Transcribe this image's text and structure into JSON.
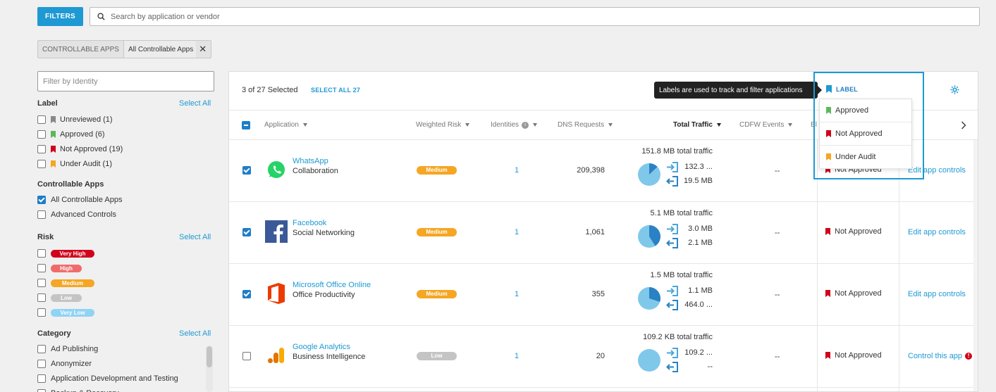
{
  "toolbar": {
    "filters_label": "FILTERS",
    "search_placeholder": "Search by application or vendor"
  },
  "chip": {
    "key": "CONTROLLABLE APPS",
    "value": "All Controllable Apps"
  },
  "sidebar": {
    "identity_placeholder": "Filter by Identity",
    "label_section": {
      "title": "Label",
      "select_all": "Select All",
      "items": [
        {
          "label": "Unreviewed (1)",
          "color": "#888888"
        },
        {
          "label": "Approved (6)",
          "color": "#5cb85c"
        },
        {
          "label": "Not Approved (19)",
          "color": "#d0021b"
        },
        {
          "label": "Under Audit (1)",
          "color": "#f5a623"
        }
      ]
    },
    "controllable_section": {
      "title": "Controllable Apps",
      "items": [
        {
          "label": "All Controllable Apps",
          "checked": true
        },
        {
          "label": "Advanced Controls",
          "checked": false
        }
      ]
    },
    "risk_section": {
      "title": "Risk",
      "select_all": "Select All",
      "items": [
        {
          "label": "Very High",
          "color": "#d0021b"
        },
        {
          "label": "High",
          "color": "#f06b6b"
        },
        {
          "label": "Medium",
          "color": "#f5a623"
        },
        {
          "label": "Low",
          "color": "#c4c4c4"
        },
        {
          "label": "Very Low",
          "color": "#8fd3f5"
        }
      ]
    },
    "category_section": {
      "title": "Category",
      "select_all": "Select All",
      "items": [
        "Ad Publishing",
        "Anonymizer",
        "Application Development and Testing",
        "Backup & Recovery"
      ]
    }
  },
  "panel": {
    "selected_text": "3 of 27 Selected",
    "select_all_link": "SELECT ALL 27",
    "label_button": "LABEL",
    "tooltip": "Labels are used to track and filter applications",
    "columns": {
      "application": "Application",
      "weighted_risk": "Weighted Risk",
      "identities": "Identities",
      "dns_requests": "DNS Requests",
      "total_traffic": "Total Traffic",
      "cdfw_events": "CDFW Events",
      "blocked_partial": "Bl"
    },
    "label_dropdown": [
      {
        "label": "Approved",
        "color": "#5cb85c"
      },
      {
        "label": "Not Approved",
        "color": "#d0021b"
      },
      {
        "label": "Under Audit",
        "color": "#f5a623"
      }
    ],
    "rows": [
      {
        "name": "WhatsApp",
        "category": "Collaboration",
        "risk": "Medium",
        "risk_color": "#f5a623",
        "identities": "1",
        "dns": "209,398",
        "total": "151.8 MB total traffic",
        "up": "132.3 ...",
        "down": "19.5 MB",
        "upload_share": 0.87,
        "cdfw": "--",
        "label": "Not Approved",
        "action": "Edit app controls",
        "checked": true,
        "icon": "whatsapp-icon"
      },
      {
        "name": "Facebook",
        "category": "Social Networking",
        "risk": "Medium",
        "risk_color": "#f5a623",
        "identities": "1",
        "dns": "1,061",
        "total": "5.1 MB total traffic",
        "up": "3.0 MB",
        "down": "2.1 MB",
        "upload_share": 0.59,
        "cdfw": "--",
        "label": "Not Approved",
        "action": "Edit app controls",
        "checked": true,
        "icon": "facebook-icon"
      },
      {
        "name": "Microsoft Office Online",
        "category": "Office Productivity",
        "risk": "Medium",
        "risk_color": "#f5a623",
        "identities": "1",
        "dns": "355",
        "total": "1.5 MB total traffic",
        "up": "1.1 MB",
        "down": "464.0 ...",
        "upload_share": 0.7,
        "cdfw": "--",
        "label": "Not Approved",
        "action": "Edit app controls",
        "checked": true,
        "icon": "office-icon"
      },
      {
        "name": "Google Analytics",
        "category": "Business Intelligence",
        "risk": "Low",
        "risk_color": "#c4c4c4",
        "identities": "1",
        "dns": "20",
        "total": "109.2 KB total traffic",
        "up": "109.2 ...",
        "down": "--",
        "upload_share": 1.0,
        "cdfw": "--",
        "label": "Not Approved",
        "action": "Control this app",
        "checked": false,
        "icon": "google-analytics-icon"
      }
    ]
  }
}
